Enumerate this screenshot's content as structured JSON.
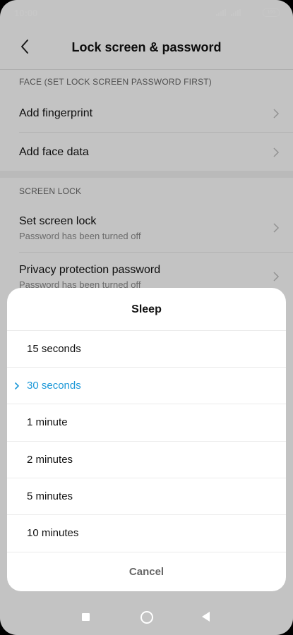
{
  "status_bar": {
    "time": "10:00",
    "battery": "100"
  },
  "header": {
    "title": "Lock screen & password"
  },
  "sections": {
    "face": {
      "label": "FACE (SET LOCK SCREEN PASSWORD FIRST)",
      "items": [
        {
          "label": "Add fingerprint"
        },
        {
          "label": "Add face data"
        }
      ]
    },
    "screen_lock": {
      "label": "SCREEN LOCK",
      "items": [
        {
          "label": "Set screen lock",
          "sub": "Password has been turned off"
        },
        {
          "label": "Privacy protection password",
          "sub": "Password has been turned off"
        }
      ]
    }
  },
  "sheet": {
    "title": "Sleep",
    "options": [
      {
        "label": "15 seconds"
      },
      {
        "label": "30 seconds"
      },
      {
        "label": "1 minute"
      },
      {
        "label": "2 minutes"
      },
      {
        "label": "5 minutes"
      },
      {
        "label": "10 minutes"
      }
    ],
    "selected_index": 1,
    "cancel": "Cancel"
  },
  "colors": {
    "accent": "#1c98d8",
    "scrim": "rgba(0,0,0,0.22)"
  }
}
